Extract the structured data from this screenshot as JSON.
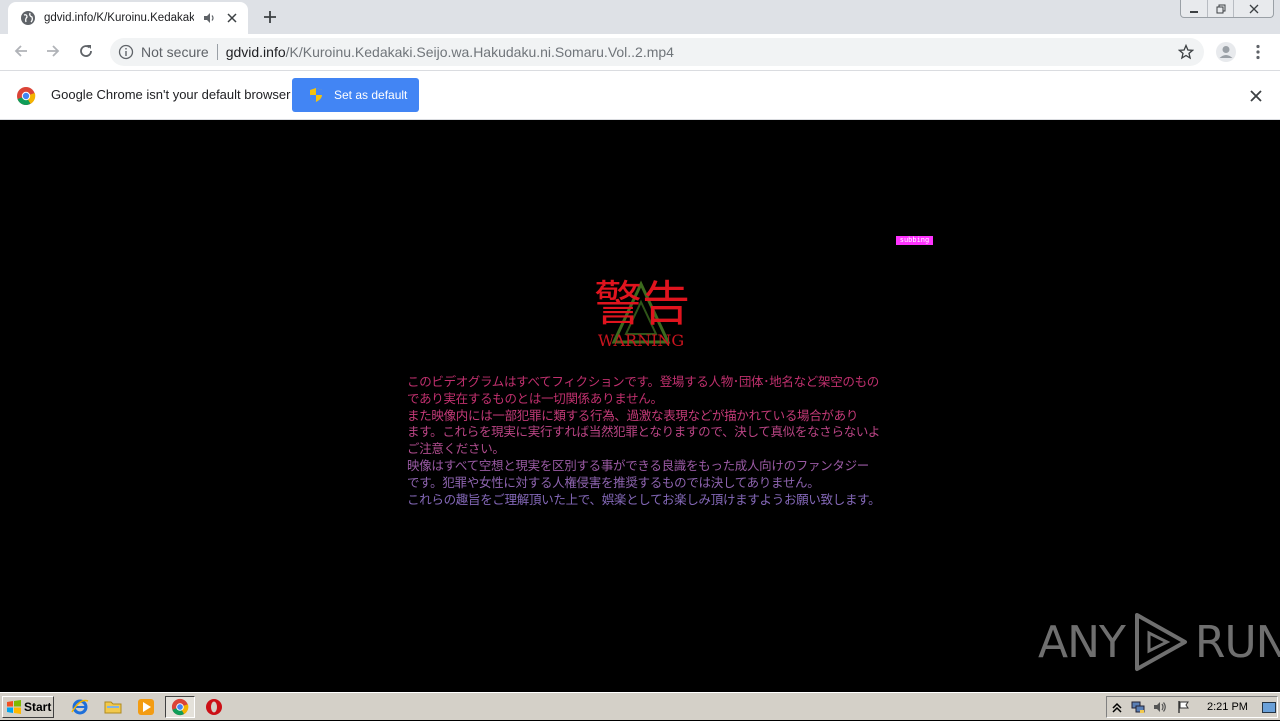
{
  "browser": {
    "tab": {
      "title": "gdvid.info/K/Kuroinu.Kedakaki.S",
      "favicon": "globe-icon",
      "audio_icon": "speaker-icon",
      "close_icon": "close-icon"
    },
    "new_tab_icon": "plus-icon",
    "window_controls": [
      "minimize-icon",
      "restore-icon",
      "close-icon"
    ],
    "toolbar": {
      "back_icon": "arrow-left-icon",
      "forward_icon": "arrow-right-icon",
      "reload_icon": "reload-icon",
      "security_label": "Not secure",
      "url_host": "gdvid.info",
      "url_path": "/K/Kuroinu.Kedakaki.Seijo.wa.Hakudaku.ni.Somaru.Vol..2.mp4",
      "bookmark_icon": "star-icon",
      "profile_icon": "avatar-icon",
      "menu_icon": "kebab-menu-icon"
    },
    "infobar": {
      "message": "Google Chrome isn't your default browser",
      "button_label": "Set as default",
      "accent_color": "#4285f4"
    }
  },
  "video": {
    "subtitle_tag": "subbing",
    "warning_title_jp": "警告",
    "warning_title_en": "WARNING",
    "warning_color": "#e0141e",
    "lines": [
      {
        "text": "このビデオグラムはすべてフィクションです。登場する人物･団体･地名など架空のもの",
        "color": "#c0306e"
      },
      {
        "text": "であり実在するものとは一切関係ありません。",
        "color": "#c0306e"
      },
      {
        "text": "また映像内には一部犯罪に類する行為、過激な表現などが描かれている場合があり",
        "color": "#c43a78"
      },
      {
        "text": "ます。これらを現実に実行すれば当然犯罪となりますので、決して真似をなさらないよう",
        "color": "#b94484"
      },
      {
        "text": "ご注意ください。",
        "color": "#b04c8e"
      },
      {
        "text": "映像はすべて空想と現実を区別する事ができる良識をもった成人向けのファンタジー",
        "color": "#9a5aa4"
      },
      {
        "text": "です。犯罪や女性に対する人権侵害を推奨するものでは決してありません。",
        "color": "#8e64b0"
      },
      {
        "text": "これらの趣旨をご理解頂いた上で、娯楽としてお楽しみ頂けますようお願い致します。",
        "color": "#8468b8"
      }
    ]
  },
  "watermark": {
    "left": "ANY",
    "right": "RUN"
  },
  "taskbar": {
    "start_label": "Start",
    "pinned": [
      "ie-icon",
      "folder-icon",
      "media-player-icon",
      "chrome-icon",
      "opera-icon"
    ],
    "tray_icons": [
      "chevron-up-icon",
      "network-icon",
      "volume-icon",
      "flag-icon"
    ],
    "clock": "2:21 PM"
  }
}
